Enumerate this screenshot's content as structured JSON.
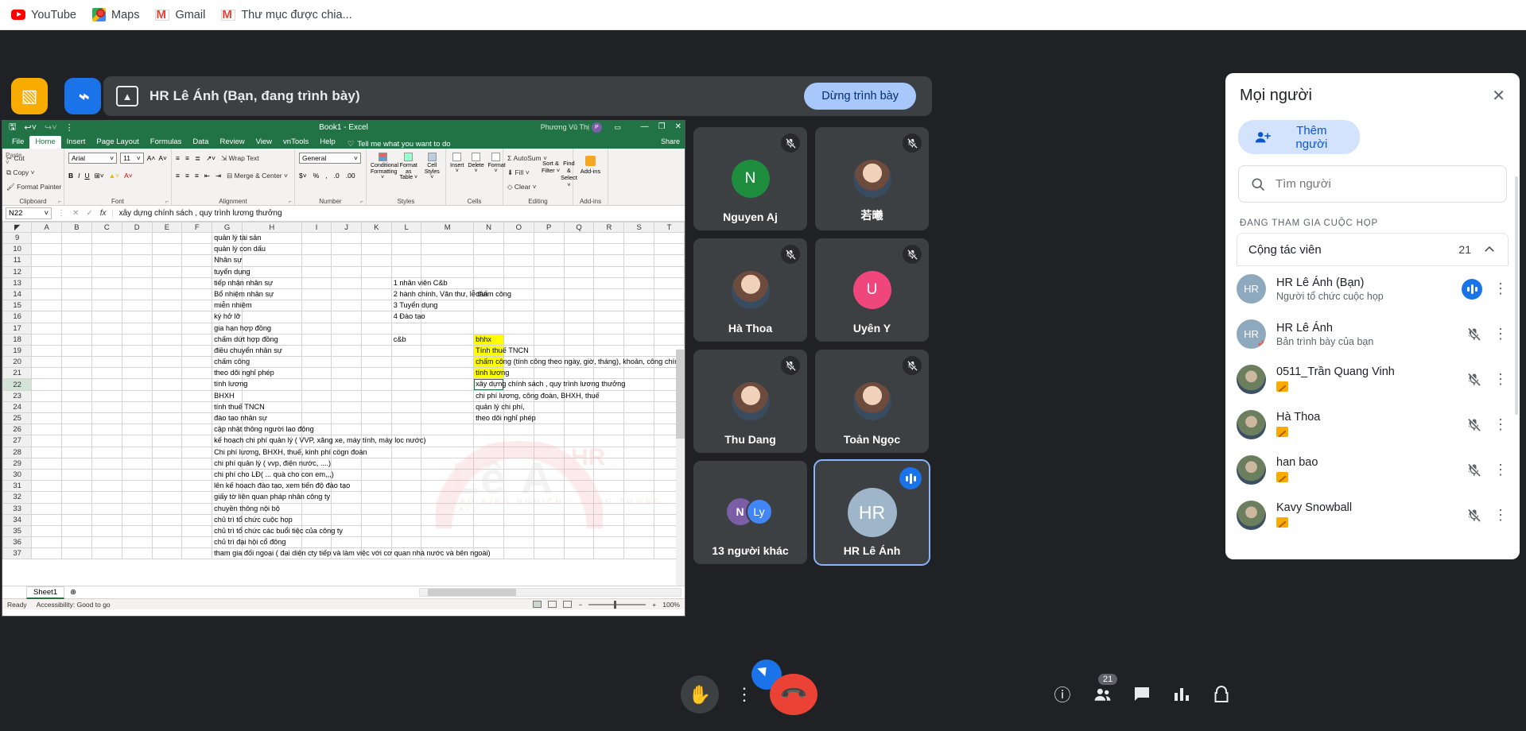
{
  "bookmarks": [
    {
      "label": "YouTube",
      "icon": "youtube-icon"
    },
    {
      "label": "Maps",
      "icon": "maps-icon"
    },
    {
      "label": "Gmail",
      "icon": "gmail-icon"
    },
    {
      "label": "Thư mục được chia...",
      "icon": "gmail-icon"
    }
  ],
  "meet": {
    "presentation_title": "HR Lê Ánh (Bạn, đang trình bày)",
    "stop_present_label": "Dừng trình bày",
    "present_icon": "present-up-icon",
    "app_icons": [
      {
        "name": "sheets-icon",
        "glyph": "▧"
      },
      {
        "name": "jamboard-icon",
        "glyph": "⌁"
      }
    ],
    "tiles": [
      {
        "name": "Nguyen Aj",
        "initial": "N",
        "color": "#1e8e3e",
        "muted": true,
        "photo": false,
        "focused": false
      },
      {
        "name": "若曦",
        "initial": "",
        "color": "#9aa0a6",
        "muted": true,
        "photo": true,
        "focused": false
      },
      {
        "name": "Hà Thoa",
        "initial": "",
        "color": "#9aa0a6",
        "muted": true,
        "photo": true,
        "focused": false
      },
      {
        "name": "Uyên Y",
        "initial": "U",
        "color": "#f0467e",
        "muted": true,
        "photo": false,
        "focused": false
      },
      {
        "name": "Thu Dang",
        "initial": "",
        "color": "#9aa0a6",
        "muted": true,
        "photo": true,
        "focused": false
      },
      {
        "name": "Toản Ngọc",
        "initial": "",
        "color": "#9aa0a6",
        "muted": true,
        "photo": true,
        "focused": false
      },
      {
        "name": "13 người khác",
        "initials": [
          "N",
          "Ly"
        ],
        "dual": true,
        "muted": false,
        "photo": false,
        "focused": false
      },
      {
        "name": "HR Lê Ánh",
        "initial": "HR",
        "color": "#9fb5c9",
        "muted": false,
        "speaking": true,
        "photo": false,
        "focused": true
      }
    ],
    "controls": {
      "hand_icon": "raise-hand-icon",
      "more_icon": "more-options-icon",
      "hangup_icon": "end-call-icon",
      "cursor_icon": "pointer-icon",
      "info_icon": "meeting-details-icon",
      "people_icon": "people-icon",
      "chat_icon": "chat-icon",
      "activities_icon": "activities-icon",
      "host_icon": "host-controls-icon",
      "people_count": "21"
    }
  },
  "panel": {
    "title": "Mọi người",
    "close_icon": "close-icon",
    "add_people_label": "Thêm người",
    "add_people_icon": "add-person-icon",
    "search_placeholder": "Tìm người",
    "search_value": "",
    "search_icon": "search-icon",
    "section_label": "ĐANG THAM GIA CUỘC HỌP",
    "group_label": "Cộng tác viên",
    "group_count": "21",
    "group_collapse_icon": "chevron-up-icon",
    "participants": [
      {
        "name": "HR Lê Ánh (Bạn)",
        "subtitle": "Người tổ chức cuộc họp",
        "avatar_text": "HR",
        "avatar_color": "#8ea9bd",
        "photo": false,
        "status": "speaking",
        "pinned": false
      },
      {
        "name": "HR Lê Ánh",
        "subtitle": "Bản trình bày của bạn",
        "avatar_text": "HR",
        "avatar_color": "#8ea9bd",
        "photo": false,
        "status": "muted",
        "pinned": true
      },
      {
        "name": "0511_Trần Quang Vinh",
        "subtitle": "",
        "avatar_text": "",
        "avatar_color": "#6b7f95",
        "photo": true,
        "status": "muted",
        "share": true
      },
      {
        "name": "Hà Thoa",
        "subtitle": "",
        "avatar_text": "",
        "avatar_color": "#7d8fa3",
        "photo": true,
        "status": "muted",
        "share": true
      },
      {
        "name": "han bao",
        "subtitle": "",
        "avatar_text": "",
        "avatar_color": "#5b7f9e",
        "photo": true,
        "status": "muted",
        "share": true
      },
      {
        "name": "Kavy Snowball",
        "subtitle": "",
        "avatar_text": "",
        "avatar_color": "#8a8a8a",
        "photo": true,
        "status": "muted",
        "share": true
      }
    ]
  },
  "excel": {
    "quick_access": [
      "save-icon",
      "undo-icon",
      "redo-icon",
      "customize-icon"
    ],
    "title": "Book1  -  Excel",
    "user": "Phương Vũ Thị",
    "user_initial": "P",
    "ribbon_display_icon": "ribbon-display-icon",
    "window_controls": [
      "minimize",
      "restore",
      "close"
    ],
    "tabs": [
      "File",
      "Home",
      "Insert",
      "Page Layout",
      "Formulas",
      "Data",
      "Review",
      "View",
      "vnTools",
      "Help"
    ],
    "active_tab": "Home",
    "tell_me": "Tell me what you want to do",
    "share_label": "Share",
    "groups": [
      {
        "name": "Clipboard",
        "items": [
          "Paste",
          "Cut",
          "Copy",
          "Format Painter"
        ]
      },
      {
        "name": "Font",
        "items": [
          "Arial",
          "11",
          "B",
          "I",
          "U",
          "Borders",
          "Fill Color",
          "Font Color"
        ]
      },
      {
        "name": "Alignment",
        "items": [
          "Wrap Text",
          "Merge & Center"
        ]
      },
      {
        "name": "Number",
        "items": [
          "General"
        ]
      },
      {
        "name": "Styles",
        "items": [
          "Conditional Formatting",
          "Format as Table",
          "Cell Styles"
        ]
      },
      {
        "name": "Cells",
        "items": [
          "Insert",
          "Delete",
          "Format"
        ]
      },
      {
        "name": "Editing",
        "items": [
          "AutoSum",
          "Fill",
          "Clear",
          "Sort & Filter",
          "Find & Select"
        ]
      },
      {
        "name": "Add-ins",
        "items": [
          "Add-ins"
        ]
      }
    ],
    "font_name": "Arial",
    "font_size": "11",
    "number_format": "General",
    "name_box": "N22",
    "formula_value": "xây dựng chính sách  , quy trình lương thưởng",
    "columns": [
      "A",
      "B",
      "C",
      "D",
      "E",
      "F",
      "G",
      "H",
      "I",
      "J",
      "K",
      "L",
      "M",
      "N",
      "O",
      "P",
      "Q",
      "R",
      "S",
      "T"
    ],
    "rows": [
      9,
      10,
      11,
      12,
      13,
      14,
      15,
      16,
      17,
      18,
      19,
      20,
      21,
      22,
      23,
      24,
      25,
      26,
      27,
      28,
      29,
      30,
      31,
      32,
      33,
      34,
      35,
      36,
      37
    ],
    "cells": [
      {
        "row": 9,
        "col": "G",
        "text": "quản lý tài sản"
      },
      {
        "row": 10,
        "col": "G",
        "text": "quản lý con dấu"
      },
      {
        "row": 11,
        "col": "G",
        "text": "Nhân sự"
      },
      {
        "row": 12,
        "col": "G",
        "text": "tuyển dụng"
      },
      {
        "row": 13,
        "col": "G",
        "text": "tiếp nhận nhân sự"
      },
      {
        "row": 13,
        "col": "L",
        "text": "1 nhân viên C&b"
      },
      {
        "row": 14,
        "col": "G",
        "text": "Bổ nhiệm nhân sự"
      },
      {
        "row": 14,
        "col": "L",
        "text": "2 hành chính, Văn thư, lễ tân"
      },
      {
        "row": 14,
        "col": "N",
        "text": "chấm công"
      },
      {
        "row": 15,
        "col": "G",
        "text": "miễn nhiệm"
      },
      {
        "row": 15,
        "col": "L",
        "text": "3 Tuyển dụng"
      },
      {
        "row": 16,
        "col": "G",
        "text": "ký hở lỡ"
      },
      {
        "row": 16,
        "col": "L",
        "text": "4 Đào tạo"
      },
      {
        "row": 17,
        "col": "G",
        "text": "gia hạn hợp đồng"
      },
      {
        "row": 18,
        "col": "G",
        "text": "chấm dứt hợp đồng"
      },
      {
        "row": 18,
        "col": "L",
        "text": "c&b"
      },
      {
        "row": 18,
        "col": "N",
        "text": "bhhx",
        "highlight": true
      },
      {
        "row": 19,
        "col": "G",
        "text": "điều chuyển nhân sự"
      },
      {
        "row": 19,
        "col": "N",
        "text": "Tính thuế TNCN",
        "highlight": true
      },
      {
        "row": 20,
        "col": "G",
        "text": "chấm công"
      },
      {
        "row": 20,
        "col": "N",
        "text": "chấm công (tính công theo ngày, giờ, tháng), khoản, công chính thức, v",
        "highlight": true
      },
      {
        "row": 21,
        "col": "G",
        "text": "theo dõi nghỉ phép"
      },
      {
        "row": 21,
        "col": "N",
        "text": "tính lương",
        "highlight": true
      },
      {
        "row": 22,
        "col": "G",
        "text": "tính lương"
      },
      {
        "row": 22,
        "col": "N",
        "text": "xây dựng chính sách  , quy trình lương thưởng",
        "selected": true
      },
      {
        "row": 23,
        "col": "G",
        "text": "BHXH"
      },
      {
        "row": 23,
        "col": "N",
        "text": "chi phí lương, công đoàn, BHXH, thuế"
      },
      {
        "row": 24,
        "col": "G",
        "text": "tính thuế TNCN"
      },
      {
        "row": 24,
        "col": "N",
        "text": "quản lý chi phí,"
      },
      {
        "row": 25,
        "col": "G",
        "text": "đào tạo nhân sự"
      },
      {
        "row": 25,
        "col": "N",
        "text": "theo dõi nghỉ phép"
      },
      {
        "row": 26,
        "col": "G",
        "text": "cập nhật thông người lao động"
      },
      {
        "row": 27,
        "col": "G",
        "text": "kế hoạch chi phí quản lý  ( VVP, xăng xe, máy tính, máy lọc nước)"
      },
      {
        "row": 28,
        "col": "G",
        "text": "Chi phí lương, BHXH, thuế, kinh phí cögn đoàn"
      },
      {
        "row": 29,
        "col": "G",
        "text": "chi phí quản lý ( vvp, điện nước, ....)"
      },
      {
        "row": 30,
        "col": "G",
        "text": "chi phí cho LĐ( ... quà cho con em,,,)"
      },
      {
        "row": 31,
        "col": "G",
        "text": "lên kế hoạch đào tạo, xem tiến độ đào tạo"
      },
      {
        "row": 32,
        "col": "G",
        "text": "giấy tờ liên quan pháp nhân công ty"
      },
      {
        "row": 33,
        "col": "G",
        "text": "chuyền thông nội bộ"
      },
      {
        "row": 34,
        "col": "G",
        "text": "chủ trì tổ chức cuộc họp"
      },
      {
        "row": 35,
        "col": "G",
        "text": "chủ trì tổ chức các buổi tiệc của  công ty"
      },
      {
        "row": 36,
        "col": "G",
        "text": "chủ trì đại hội cổ đông"
      },
      {
        "row": 37,
        "col": "G",
        "text": "tham gia đối ngoại ( đại diện cty tiếp và làm việc với cơ quan nhà nước và bên ngoài)"
      }
    ],
    "watermark": {
      "main": "Lê Á",
      "badge": "HR",
      "sub": "ĐÀO KINH NGHIỆM - CÙNG TƯƠNG LAI"
    },
    "sheet_tab": "Sheet1",
    "add_sheet_icon": "add-sheet-icon",
    "status_left": "Ready",
    "status_accessibility": "Accessibility: Good to go",
    "zoom_level": "100%"
  }
}
